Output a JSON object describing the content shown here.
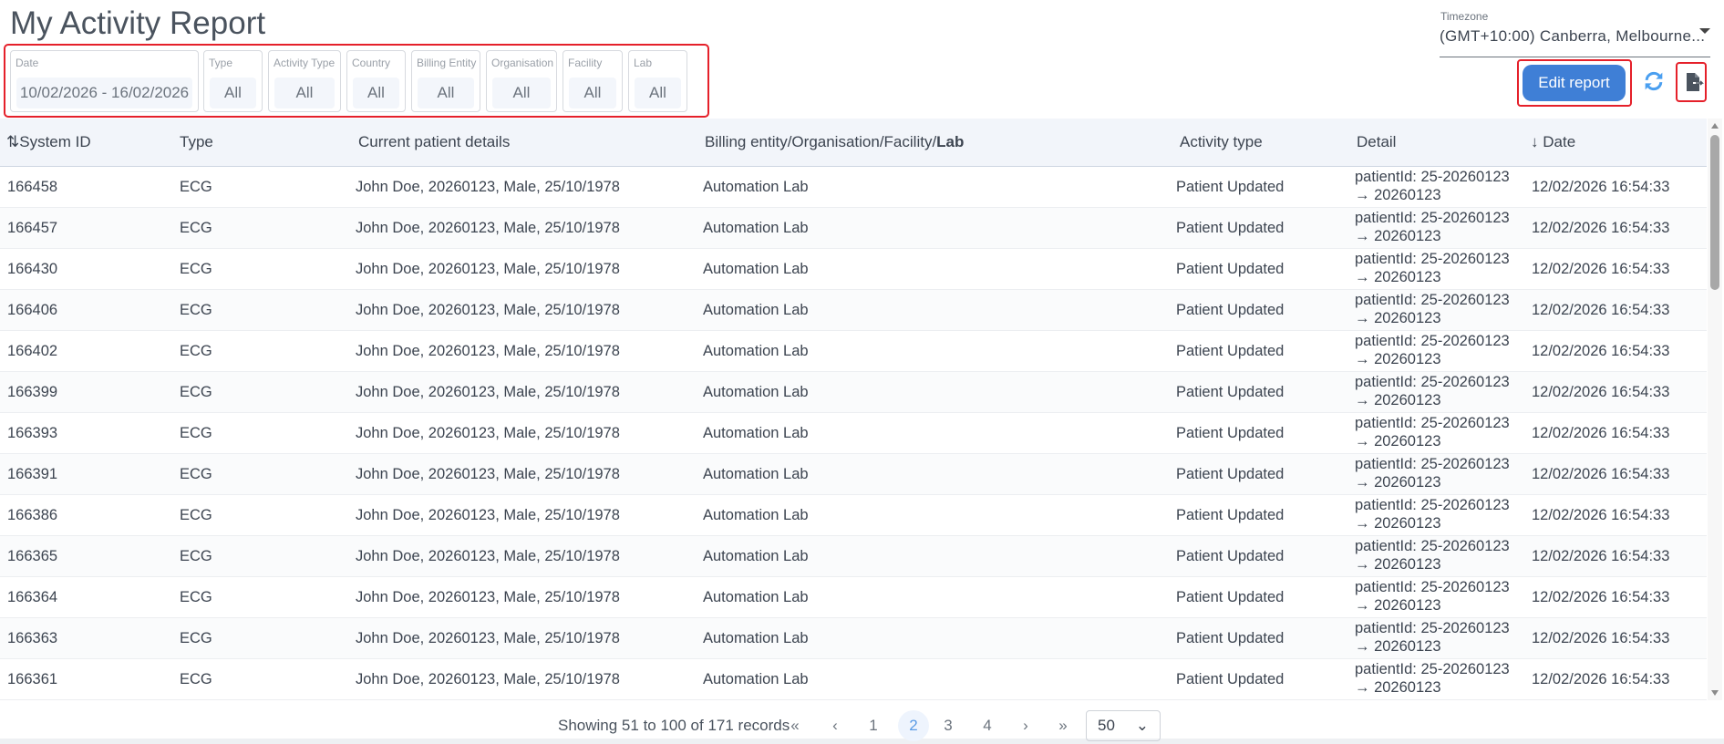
{
  "title": "My Activity Report",
  "filters": [
    {
      "label": "Date",
      "value": "10/02/2026 - 16/02/2026"
    },
    {
      "label": "Type",
      "value": "All"
    },
    {
      "label": "Activity Type",
      "value": "All"
    },
    {
      "label": "Country",
      "value": "All"
    },
    {
      "label": "Billing Entity",
      "value": "All"
    },
    {
      "label": "Organisation",
      "value": "All"
    },
    {
      "label": "Facility",
      "value": "All"
    },
    {
      "label": "Lab",
      "value": "All"
    }
  ],
  "timezone": {
    "label": "Timezone",
    "value": "(GMT+10:00) Canberra, Melbourne..."
  },
  "toolbar": {
    "edit_label": "Edit report",
    "refresh_icon": "refresh-icon",
    "export_icon": "file-export-icon",
    "accent": "#3f7fd6"
  },
  "table": {
    "headers": {
      "system_id": "System ID",
      "type": "Type",
      "patient": "Current patient details",
      "billing": "Billing entity/Organisation/Facility/",
      "billing_bold": "Lab",
      "activity": "Activity type",
      "detail": "Detail",
      "date": "Date"
    },
    "sort_icons": {
      "system_id": "sort-icon",
      "date": "sort-descending-icon"
    },
    "rows": [
      {
        "id": "166458",
        "type": "ECG",
        "patient": "John Doe, 20260123, Male, 25/10/1978",
        "billing": "Automation Lab",
        "activity": "Patient Updated",
        "detail1": "patientId: 25-20260123",
        "detail2": "→ 20260123",
        "date": "12/02/2026 16:54:33"
      },
      {
        "id": "166457",
        "type": "ECG",
        "patient": "John Doe, 20260123, Male, 25/10/1978",
        "billing": "Automation Lab",
        "activity": "Patient Updated",
        "detail1": "patientId: 25-20260123",
        "detail2": "→ 20260123",
        "date": "12/02/2026 16:54:33"
      },
      {
        "id": "166430",
        "type": "ECG",
        "patient": "John Doe, 20260123, Male, 25/10/1978",
        "billing": "Automation Lab",
        "activity": "Patient Updated",
        "detail1": "patientId: 25-20260123",
        "detail2": "→ 20260123",
        "date": "12/02/2026 16:54:33"
      },
      {
        "id": "166406",
        "type": "ECG",
        "patient": "John Doe, 20260123, Male, 25/10/1978",
        "billing": "Automation Lab",
        "activity": "Patient Updated",
        "detail1": "patientId: 25-20260123",
        "detail2": "→ 20260123",
        "date": "12/02/2026 16:54:33"
      },
      {
        "id": "166402",
        "type": "ECG",
        "patient": "John Doe, 20260123, Male, 25/10/1978",
        "billing": "Automation Lab",
        "activity": "Patient Updated",
        "detail1": "patientId: 25-20260123",
        "detail2": "→ 20260123",
        "date": "12/02/2026 16:54:33"
      },
      {
        "id": "166399",
        "type": "ECG",
        "patient": "John Doe, 20260123, Male, 25/10/1978",
        "billing": "Automation Lab",
        "activity": "Patient Updated",
        "detail1": "patientId: 25-20260123",
        "detail2": "→ 20260123",
        "date": "12/02/2026 16:54:33"
      },
      {
        "id": "166393",
        "type": "ECG",
        "patient": "John Doe, 20260123, Male, 25/10/1978",
        "billing": "Automation Lab",
        "activity": "Patient Updated",
        "detail1": "patientId: 25-20260123",
        "detail2": "→ 20260123",
        "date": "12/02/2026 16:54:33"
      },
      {
        "id": "166391",
        "type": "ECG",
        "patient": "John Doe, 20260123, Male, 25/10/1978",
        "billing": "Automation Lab",
        "activity": "Patient Updated",
        "detail1": "patientId: 25-20260123",
        "detail2": "→ 20260123",
        "date": "12/02/2026 16:54:33"
      },
      {
        "id": "166386",
        "type": "ECG",
        "patient": "John Doe, 20260123, Male, 25/10/1978",
        "billing": "Automation Lab",
        "activity": "Patient Updated",
        "detail1": "patientId: 25-20260123",
        "detail2": "→ 20260123",
        "date": "12/02/2026 16:54:33"
      },
      {
        "id": "166365",
        "type": "ECG",
        "patient": "John Doe, 20260123, Male, 25/10/1978",
        "billing": "Automation Lab",
        "activity": "Patient Updated",
        "detail1": "patientId: 25-20260123",
        "detail2": "→ 20260123",
        "date": "12/02/2026 16:54:33"
      },
      {
        "id": "166364",
        "type": "ECG",
        "patient": "John Doe, 20260123, Male, 25/10/1978",
        "billing": "Automation Lab",
        "activity": "Patient Updated",
        "detail1": "patientId: 25-20260123",
        "detail2": "→ 20260123",
        "date": "12/02/2026 16:54:33"
      },
      {
        "id": "166363",
        "type": "ECG",
        "patient": "John Doe, 20260123, Male, 25/10/1978",
        "billing": "Automation Lab",
        "activity": "Patient Updated",
        "detail1": "patientId: 25-20260123",
        "detail2": "→ 20260123",
        "date": "12/02/2026 16:54:33"
      },
      {
        "id": "166361",
        "type": "ECG",
        "patient": "John Doe, 20260123, Male, 25/10/1978",
        "billing": "Automation Lab",
        "activity": "Patient Updated",
        "detail1": "patientId: 25-20260123",
        "detail2": "→ 20260123",
        "date": "12/02/2026 16:54:33"
      }
    ]
  },
  "pagination": {
    "info": "Showing 51 to 100 of 171 records",
    "first": "«",
    "prev": "‹",
    "pages": [
      "1",
      "2",
      "3",
      "4"
    ],
    "current": "2",
    "next": "›",
    "last": "»",
    "page_size": "50"
  }
}
